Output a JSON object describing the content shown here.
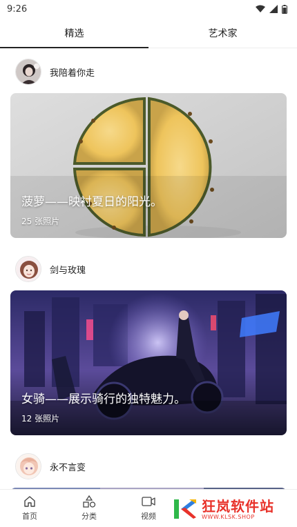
{
  "status_bar": {
    "time": "9:26"
  },
  "tabs": [
    {
      "label": "精选",
      "active": true
    },
    {
      "label": "艺术家",
      "active": false
    }
  ],
  "posts": [
    {
      "username": "我陪着你走",
      "title": "菠萝——映衬夏日的阳光。",
      "count": "25 张照片"
    },
    {
      "username": "剑与玫瑰",
      "title": "女骑——展示骑行的独特魅力。",
      "count": "12 张照片"
    },
    {
      "username": "永不言变"
    }
  ],
  "bottom_nav": [
    {
      "label": "首页",
      "icon": "home-icon"
    },
    {
      "label": "分类",
      "icon": "category-icon"
    },
    {
      "label": "视频",
      "icon": "video-icon"
    }
  ],
  "watermark": {
    "text": "狂岚软件站",
    "url": "WWW.KLSK.SHOP"
  },
  "colors": {
    "accent": "#222222",
    "watermark": "#e8322a"
  }
}
